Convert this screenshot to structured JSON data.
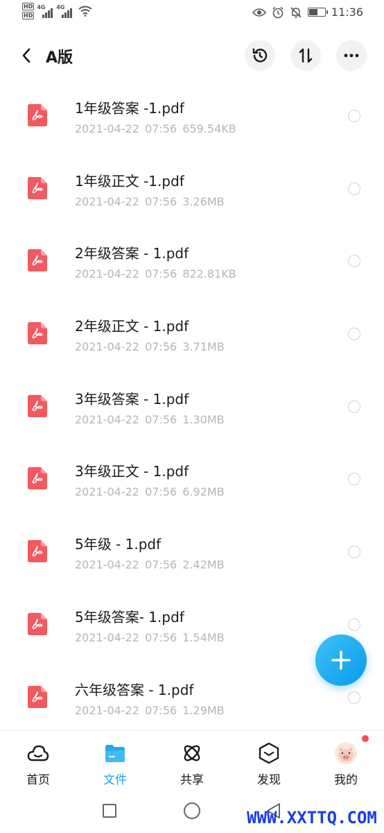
{
  "status_bar": {
    "hd1": "HD",
    "hd2": "HD",
    "signal1": "4G",
    "signal2": "4G",
    "time": "11:36",
    "battery_level": 0.55
  },
  "header": {
    "title": "A版",
    "icons": [
      "back-arrow-icon",
      "history-icon",
      "sort-icon",
      "more-icon"
    ]
  },
  "files": [
    {
      "name": "1年级答案 -1.pdf",
      "meta": "2021-04-22 07:56 659.54KB"
    },
    {
      "name": "1年级正文 -1.pdf",
      "meta": "2021-04-22 07:56 3.26MB"
    },
    {
      "name": "2年级答案 - 1.pdf",
      "meta": "2021-04-22 07:56 822.81KB"
    },
    {
      "name": "2年级正文 - 1.pdf",
      "meta": "2021-04-22 07:56 3.71MB"
    },
    {
      "name": "3年级答案 - 1.pdf",
      "meta": "2021-04-22 07:56 1.30MB"
    },
    {
      "name": "3年级正文 - 1.pdf",
      "meta": "2021-04-22 07:56 6.92MB"
    },
    {
      "name": "5年级 - 1.pdf",
      "meta": "2021-04-22 07:56 2.42MB"
    },
    {
      "name": "5年级答案- 1.pdf",
      "meta": "2021-04-22 07:56 1.54MB"
    },
    {
      "name": "六年级答案 - 1.pdf",
      "meta": "2021-04-22 07:56 1.29MB"
    }
  ],
  "bottom_nav": [
    {
      "label": "首页",
      "icon": "cloud-icon",
      "active": false
    },
    {
      "label": "文件",
      "icon": "folder-icon",
      "active": true
    },
    {
      "label": "共享",
      "icon": "atom-icon",
      "active": false
    },
    {
      "label": "发现",
      "icon": "discover-icon",
      "active": false
    },
    {
      "label": "我的",
      "icon": "avatar-icon",
      "active": false
    }
  ],
  "watermark": "WWW.XXTTQ.COM",
  "colors": {
    "accent": "#1aa3ef",
    "pdf_icon": "#f25a5f",
    "meta_text": "#b2b5bb",
    "notification_dot": "#f04d5a"
  }
}
